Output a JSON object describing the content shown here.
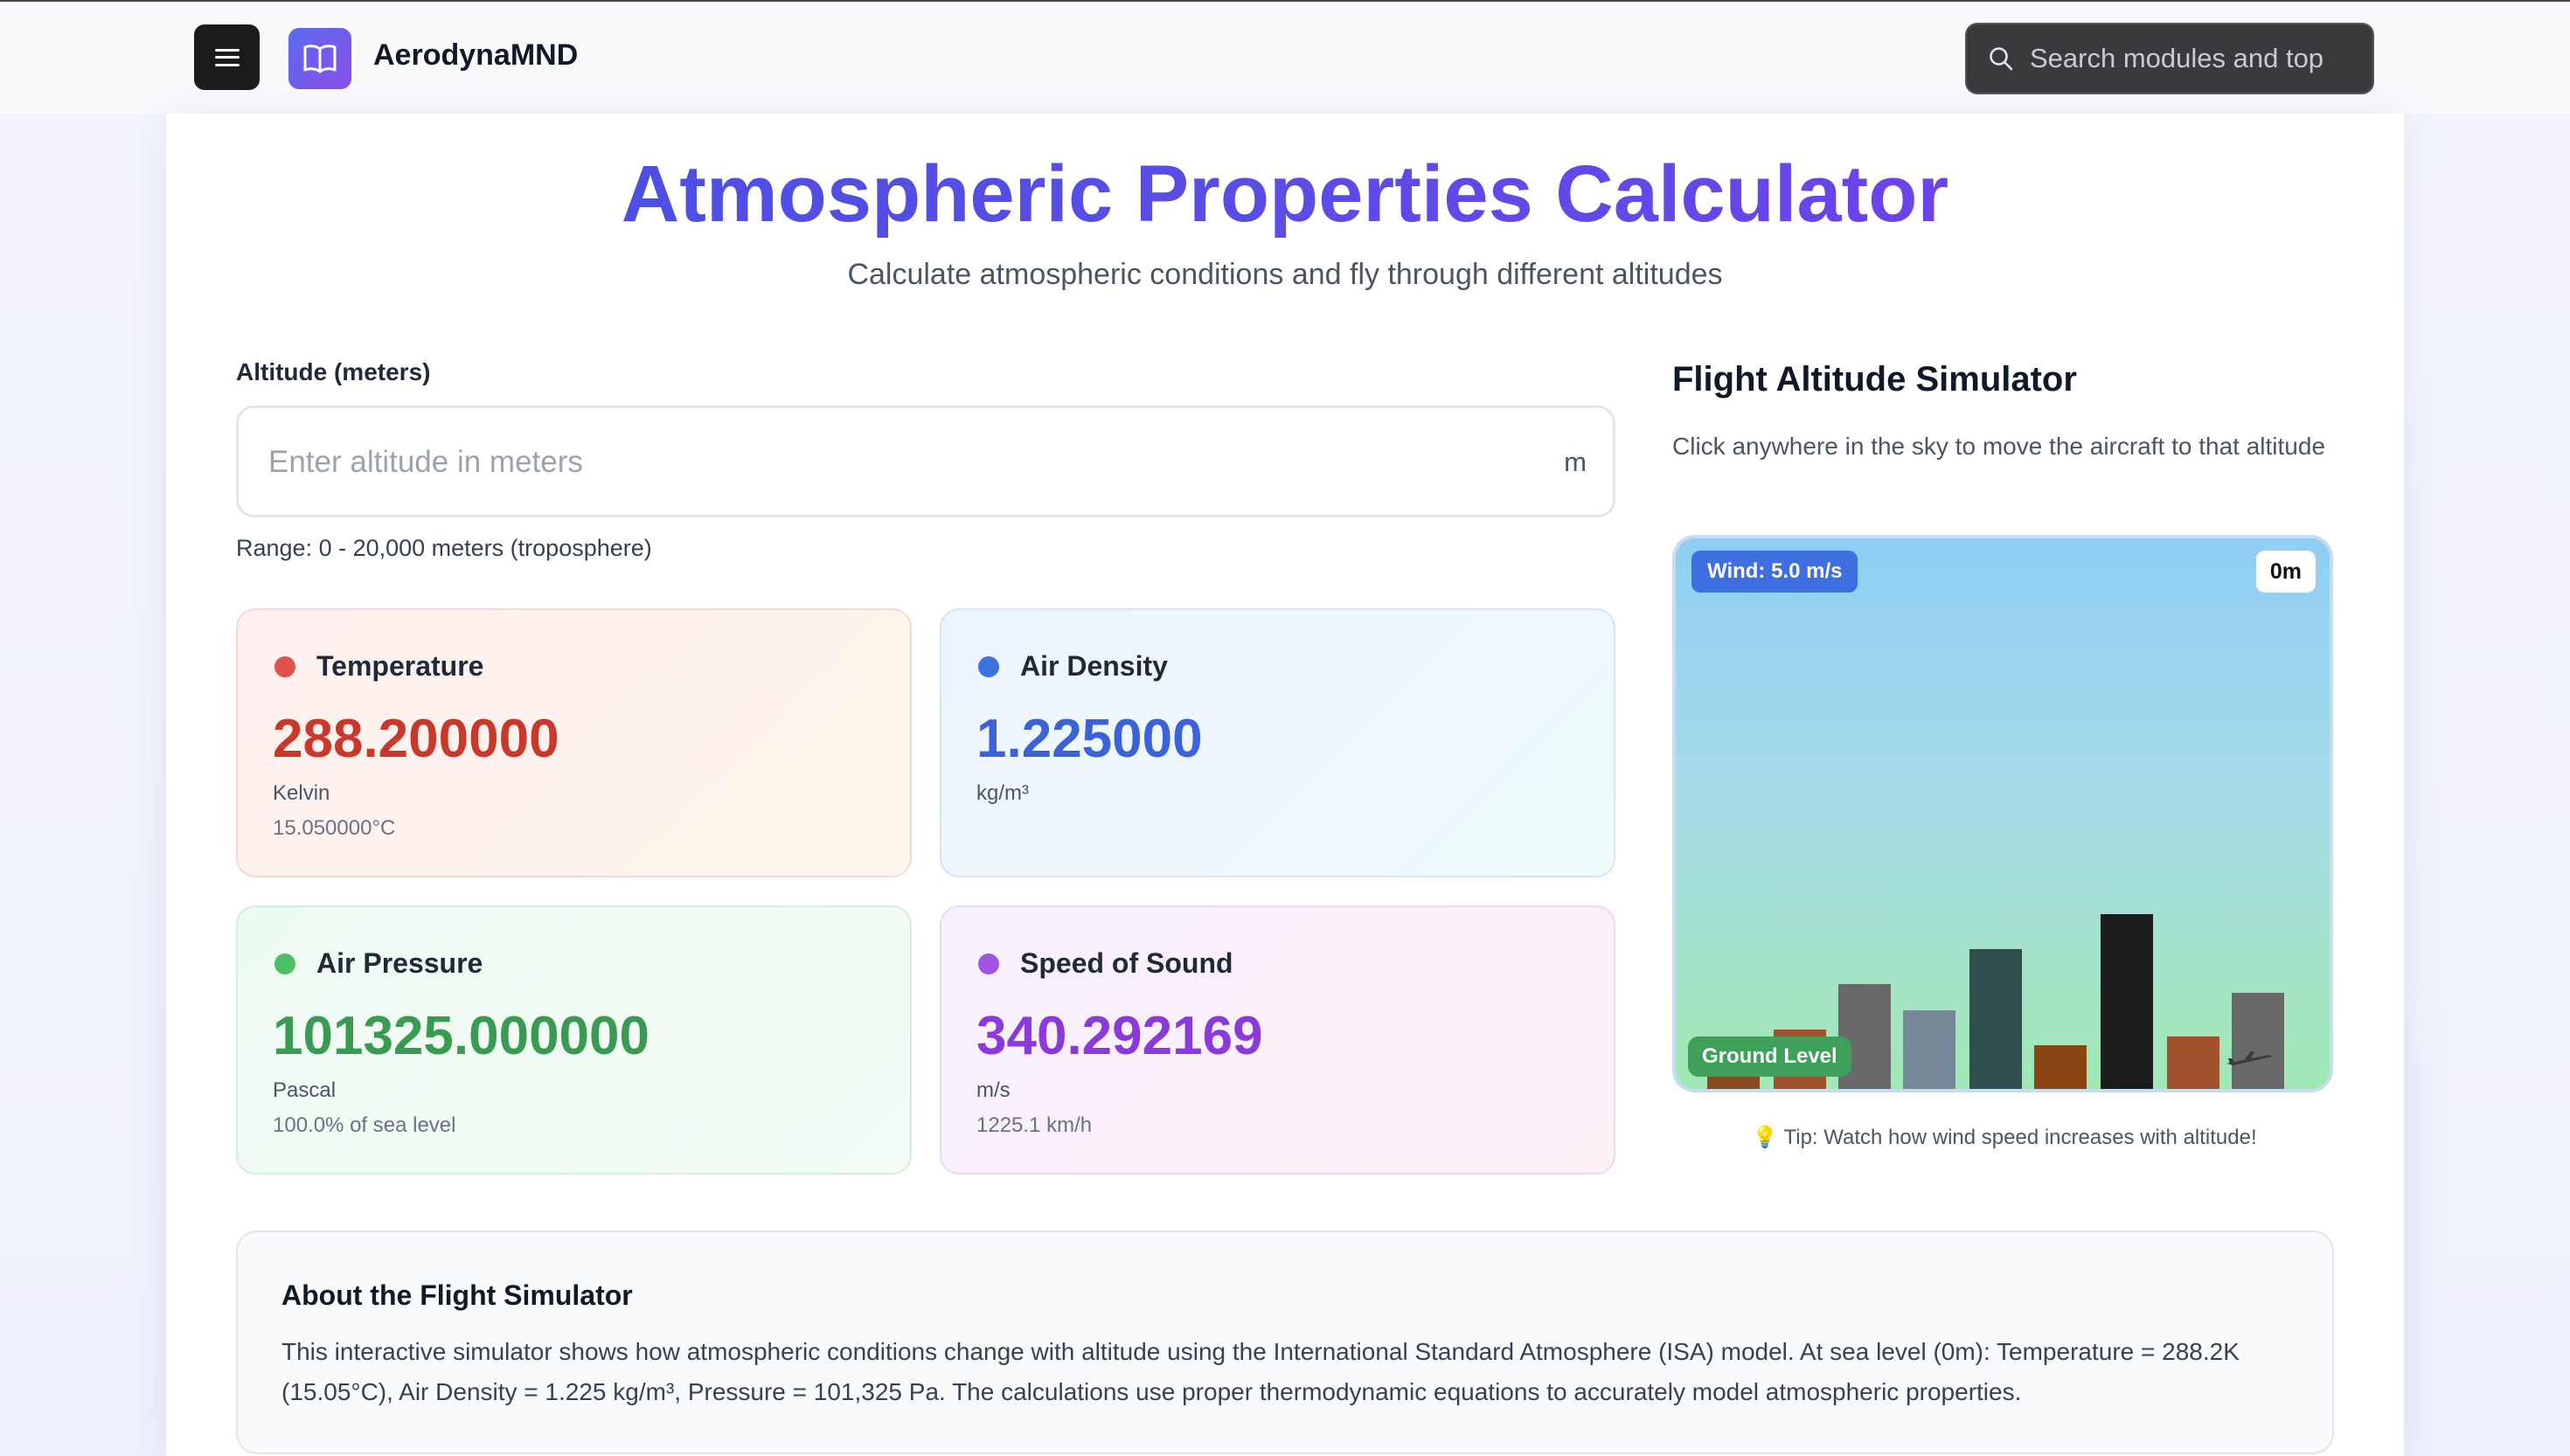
{
  "header": {
    "brand": "AerodynaMND",
    "search_placeholder": "Search modules and top"
  },
  "page": {
    "title": "Atmospheric Properties Calculator",
    "subtitle": "Calculate atmospheric conditions and fly through different altitudes"
  },
  "altitude": {
    "label": "Altitude (meters)",
    "placeholder": "Enter altitude in meters",
    "value": "",
    "unit": "m",
    "range": "Range: 0 - 20,000 meters (troposphere)"
  },
  "metrics": {
    "temperature": {
      "name": "Temperature",
      "value": "288.200000",
      "unit": "Kelvin",
      "sub": "15.050000°C",
      "color": "#c8392b",
      "dot": "#e0524a"
    },
    "density": {
      "name": "Air Density",
      "value": "1.225000",
      "unit": "kg/m³",
      "sub": "",
      "color": "#3b62d9",
      "dot": "#3f72e0"
    },
    "pressure": {
      "name": "Air Pressure",
      "value": "101325.000000",
      "unit": "Pascal",
      "sub": "100.0% of sea level",
      "color": "#3a9a52",
      "dot": "#4cbf67"
    },
    "sound": {
      "name": "Speed of Sound",
      "value": "340.292169",
      "unit": "m/s",
      "sub": "1225.1 km/h",
      "color": "#8a3ad8",
      "dot": "#a155e0"
    }
  },
  "simulator": {
    "title": "Flight Altitude Simulator",
    "description": "Click anywhere in the sky to move the aircraft to that altitude",
    "wind": "Wind: 5.0 m/s",
    "current_altitude": "0m",
    "ground_label": "Ground Level",
    "tip": "💡 Tip: Watch how wind speed increases with altitude!"
  },
  "about": {
    "title": "About the Flight Simulator",
    "text": "This interactive simulator shows how atmospheric conditions change with altitude using the International Standard Atmosphere (ISA) model. At sea level (0m): Temperature = 288.2K (15.05°C), Air Density = 1.225 kg/m³, Pressure = 101,325 Pa. The calculations use proper thermodynamic equations to accurately model atmospheric properties."
  }
}
